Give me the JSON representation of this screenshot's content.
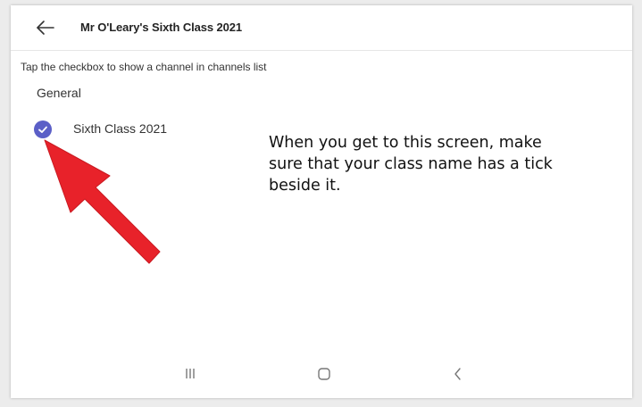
{
  "header": {
    "back_icon": "arrow-left-icon",
    "title": "Mr O'Leary's Sixth Class 2021"
  },
  "instruction": "Tap the checkbox to show a channel in channels list",
  "team": {
    "name": "General",
    "channels": [
      {
        "label": "Sixth Class 2021",
        "checked": true,
        "icon": "check-circle-icon"
      }
    ]
  },
  "annotation": {
    "text": "When you get to this screen, make sure that your class name has a tick beside it.",
    "arrow_icon": "red-arrow-icon",
    "arrow_color": "#e8222a"
  },
  "colors": {
    "accent": "#5b5fc7",
    "annotation_arrow": "#e8222a"
  },
  "system_nav": [
    {
      "name": "recent-apps-icon"
    },
    {
      "name": "home-icon"
    },
    {
      "name": "back-icon"
    }
  ]
}
